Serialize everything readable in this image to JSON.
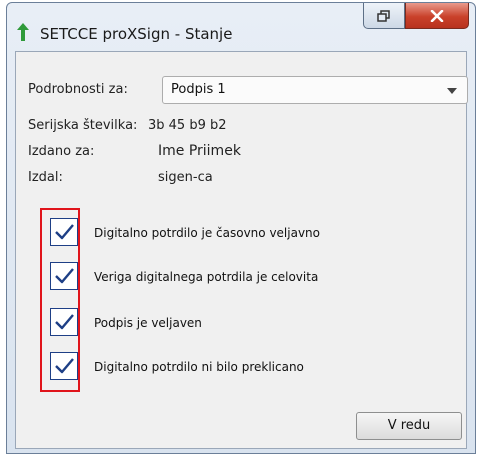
{
  "window": {
    "title": "SETCCE proXSign - Stanje"
  },
  "details": {
    "label": "Podrobnosti za:",
    "selected": "Podpis 1",
    "serial_label": "Serijska številka:",
    "serial_value": "3b 45 b9 b2",
    "issued_to_label": "Izdano za:",
    "issued_to_value": "Ime Priimek",
    "issuer_label": "Izdal:",
    "issuer_value": "sigen-ca"
  },
  "checks": [
    {
      "label": "Digitalno potrdilo je časovno veljavno",
      "checked": true
    },
    {
      "label": "Veriga digitalnega potrdila je celovita",
      "checked": true
    },
    {
      "label": "Podpis je veljaven",
      "checked": true
    },
    {
      "label": "Digitalno potrdilo ni bilo preklicano",
      "checked": true
    }
  ],
  "buttons": {
    "ok": "V redu"
  },
  "colors": {
    "highlight": "#e0141b",
    "check": "#1e3f86"
  }
}
